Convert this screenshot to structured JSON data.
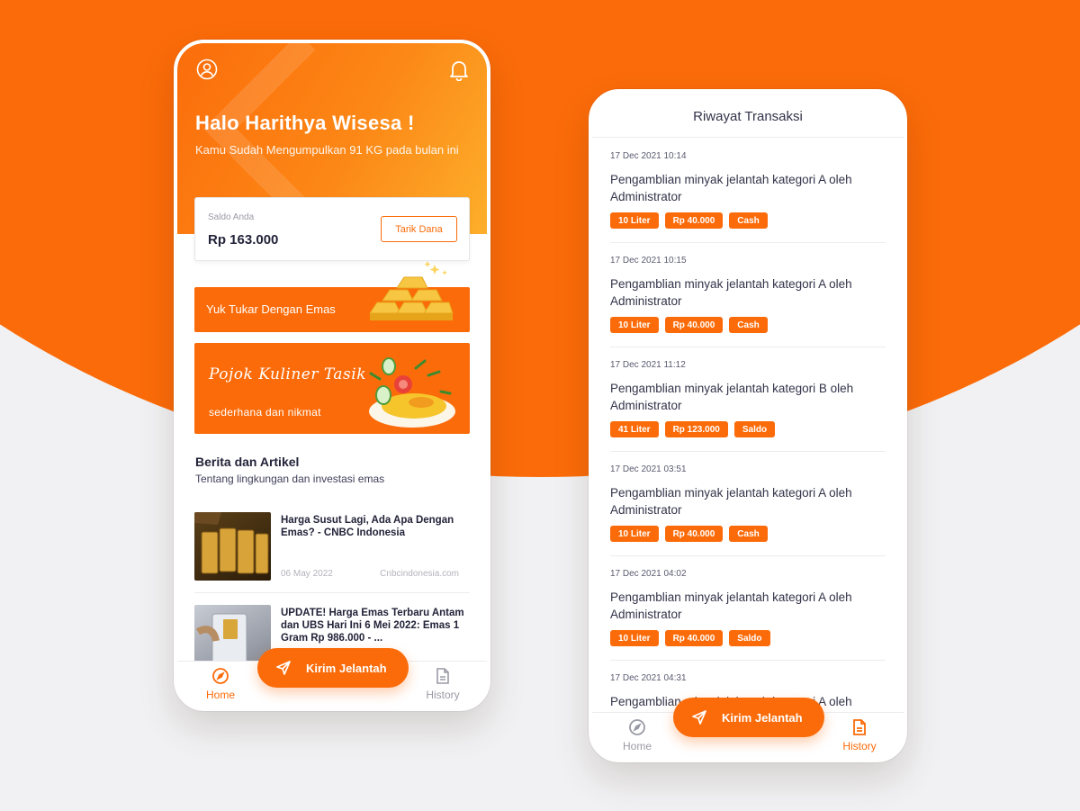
{
  "colors": {
    "accent": "#fb6b09",
    "background": "#f1f1f3"
  },
  "home": {
    "greeting": "Halo Harithya Wisesa !",
    "summary": "Kamu Sudah Mengumpulkan 91 KG pada bulan ini",
    "balance": {
      "label": "Saldo Anda",
      "value": "Rp 163.000",
      "withdraw_label": "Tarik Dana"
    },
    "banners": {
      "gold": "Yuk Tukar Dengan Emas",
      "food_title": "Pojok Kuliner Tasik",
      "food_tagline": "sederhana dan nikmat"
    },
    "news": {
      "title": "Berita dan Artikel",
      "subtitle": "Tentang lingkungan dan investasi emas",
      "items": [
        {
          "headline": "Harga Susut Lagi, Ada Apa Dengan Emas? - CNBC Indonesia",
          "date": "06 May 2022",
          "source": "Cnbcindonesia.com"
        },
        {
          "headline": "UPDATE! Harga Emas Terbaru Antam dan UBS Hari Ini 6 Mei 2022: Emas 1 Gram Rp 986.000 - ...",
          "date": "",
          "source": ""
        }
      ]
    },
    "nav": {
      "home": "Home",
      "history": "History",
      "fab": "Kirim Jelantah"
    }
  },
  "history": {
    "title": "Riwayat Transaksi",
    "transactions": [
      {
        "date": "17 Dec 2021 10:14",
        "description": "Pengamblian minyak jelantah kategori A oleh Administrator",
        "volume": "10 Liter",
        "amount": "Rp 40.000",
        "method": "Cash"
      },
      {
        "date": "17 Dec 2021 10:15",
        "description": "Pengamblian minyak jelantah kategori A oleh Administrator",
        "volume": "10 Liter",
        "amount": "Rp 40.000",
        "method": "Cash"
      },
      {
        "date": "17 Dec 2021 11:12",
        "description": "Pengamblian minyak jelantah kategori B oleh Administrator",
        "volume": "41 Liter",
        "amount": "Rp 123.000",
        "method": "Saldo"
      },
      {
        "date": "17 Dec 2021 03:51",
        "description": "Pengamblian minyak jelantah kategori A oleh Administrator",
        "volume": "10 Liter",
        "amount": "Rp 40.000",
        "method": "Cash"
      },
      {
        "date": "17 Dec 2021 04:02",
        "description": "Pengamblian minyak jelantah kategori A oleh Administrator",
        "volume": "10 Liter",
        "amount": "Rp 40.000",
        "method": "Saldo"
      },
      {
        "date": "17 Dec 2021 04:31",
        "description": "Pengamblian minyak jelantah kategori A oleh",
        "volume": "",
        "amount": "",
        "method": ""
      }
    ],
    "nav": {
      "home": "Home",
      "history": "History",
      "fab": "Kirim Jelantah"
    }
  }
}
